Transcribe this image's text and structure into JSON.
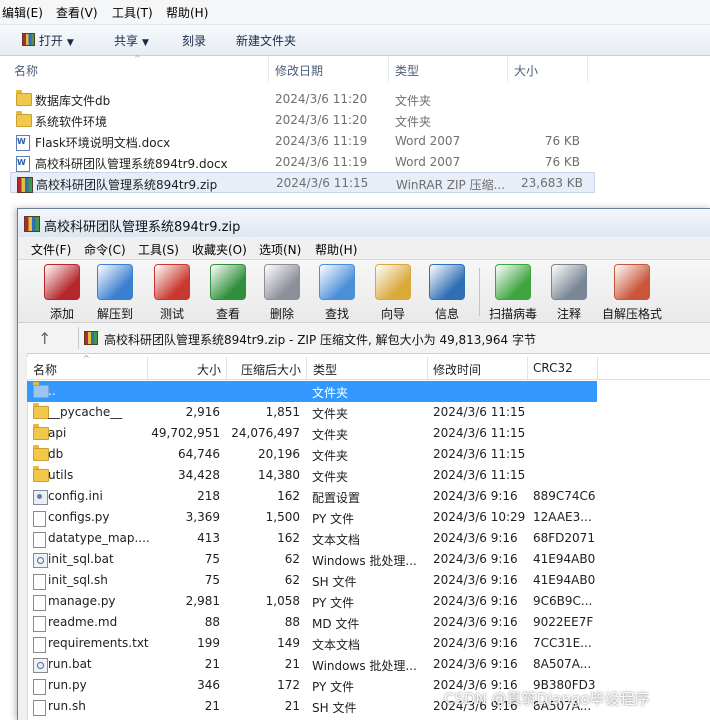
{
  "explorer": {
    "menu": [
      "编辑(E)",
      "查看(V)",
      "工具(T)",
      "帮助(H)"
    ],
    "toolbar": {
      "open": "打开",
      "share": "共享",
      "burn": "刻录",
      "new_folder": "新建文件夹"
    },
    "columns": {
      "name": "名称",
      "modified": "修改日期",
      "type": "类型",
      "size": "大小"
    },
    "rows": [
      {
        "name": "数据库文件db",
        "modified": "2024/3/6 11:20",
        "type": "文件夹",
        "size": "",
        "icon": "folder-icon"
      },
      {
        "name": "系统软件环境",
        "modified": "2024/3/6 11:20",
        "type": "文件夹",
        "size": "",
        "icon": "folder-icon"
      },
      {
        "name": "Flask环境说明文档.docx",
        "modified": "2024/3/6 11:19",
        "type": "Word 2007",
        "size": "76 KB",
        "icon": "word-doc-icon"
      },
      {
        "name": "高校科研团队管理系统894tr9.docx",
        "modified": "2024/3/6 11:19",
        "type": "Word 2007",
        "size": "76 KB",
        "icon": "word-doc-icon"
      },
      {
        "name": "高校科研团队管理系统894tr9.zip",
        "modified": "2024/3/6 11:15",
        "type": "WinRAR ZIP 压缩...",
        "size": "23,683 KB",
        "icon": "winrar-archive-icon"
      }
    ]
  },
  "winrar": {
    "title": "高校科研团队管理系统894tr9.zip",
    "menu": [
      "文件(F)",
      "命令(C)",
      "工具(S)",
      "收藏夹(O)",
      "选项(N)",
      "帮助(H)"
    ],
    "tools": [
      {
        "label": "添加",
        "icon": "add-archive-icon",
        "color": "#b4282d"
      },
      {
        "label": "解压到",
        "icon": "extract-to-icon",
        "color": "#3b7fd0"
      },
      {
        "label": "测试",
        "icon": "test-icon",
        "color": "#c8382e"
      },
      {
        "label": "查看",
        "icon": "view-book-icon",
        "color": "#2f8f3a"
      },
      {
        "label": "删除",
        "icon": "delete-trash-icon",
        "color": "#8a8f98"
      },
      {
        "label": "查找",
        "icon": "find-magnifier-icon",
        "color": "#4a90d9"
      },
      {
        "label": "向导",
        "icon": "wizard-wand-icon",
        "color": "#d9a93a"
      },
      {
        "label": "信息",
        "icon": "info-icon",
        "color": "#2f6fb5"
      },
      {
        "label": "扫描病毒",
        "icon": "virus-scan-icon",
        "color": "#3ea53e"
      },
      {
        "label": "注释",
        "icon": "comment-icon",
        "color": "#7a8696"
      },
      {
        "label": "自解压格式",
        "icon": "sfx-archive-icon",
        "color": "#c9563a"
      }
    ],
    "address": "高校科研团队管理系统894tr9.zip - ZIP 压缩文件, 解包大小为 49,813,964 字节",
    "columns": {
      "name": "名称",
      "size": "大小",
      "packed": "压缩后大小",
      "type": "类型",
      "modified": "修改时间",
      "crc": "CRC32"
    },
    "files": [
      {
        "name": "..",
        "size": "",
        "packed": "",
        "type": "文件夹",
        "modified": "",
        "crc": "",
        "icon": "updir"
      },
      {
        "name": "__pycache__",
        "size": "2,916",
        "packed": "1,851",
        "type": "文件夹",
        "modified": "2024/3/6 11:15",
        "crc": "",
        "icon": "folder"
      },
      {
        "name": "api",
        "size": "49,702,951",
        "packed": "24,076,497",
        "type": "文件夹",
        "modified": "2024/3/6 11:15",
        "crc": "",
        "icon": "folder"
      },
      {
        "name": "db",
        "size": "64,746",
        "packed": "20,196",
        "type": "文件夹",
        "modified": "2024/3/6 11:15",
        "crc": "",
        "icon": "folder"
      },
      {
        "name": "utils",
        "size": "34,428",
        "packed": "14,380",
        "type": "文件夹",
        "modified": "2024/3/6 11:15",
        "crc": "",
        "icon": "folder"
      },
      {
        "name": "config.ini",
        "size": "218",
        "packed": "162",
        "type": "配置设置",
        "modified": "2024/3/6 9:16",
        "crc": "889C74C6",
        "icon": "ini"
      },
      {
        "name": "configs.py",
        "size": "3,369",
        "packed": "1,500",
        "type": "PY 文件",
        "modified": "2024/3/6 10:29",
        "crc": "12AAE3...",
        "icon": "file"
      },
      {
        "name": "datatype_map....",
        "size": "413",
        "packed": "162",
        "type": "文本文档",
        "modified": "2024/3/6 9:16",
        "crc": "68FD2071",
        "icon": "file"
      },
      {
        "name": "init_sql.bat",
        "size": "75",
        "packed": "62",
        "type": "Windows 批处理...",
        "modified": "2024/3/6 9:16",
        "crc": "41E94AB0",
        "icon": "bat"
      },
      {
        "name": "init_sql.sh",
        "size": "75",
        "packed": "62",
        "type": "SH 文件",
        "modified": "2024/3/6 9:16",
        "crc": "41E94AB0",
        "icon": "file"
      },
      {
        "name": "manage.py",
        "size": "2,981",
        "packed": "1,058",
        "type": "PY 文件",
        "modified": "2024/3/6 9:16",
        "crc": "9C6B9C...",
        "icon": "file"
      },
      {
        "name": "readme.md",
        "size": "88",
        "packed": "88",
        "type": "MD 文件",
        "modified": "2024/3/6 9:16",
        "crc": "9022EE7F",
        "icon": "file"
      },
      {
        "name": "requirements.txt",
        "size": "199",
        "packed": "149",
        "type": "文本文档",
        "modified": "2024/3/6 9:16",
        "crc": "7CC31E...",
        "icon": "file"
      },
      {
        "name": "run.bat",
        "size": "21",
        "packed": "21",
        "type": "Windows 批处理...",
        "modified": "2024/3/6 9:16",
        "crc": "8A507A...",
        "icon": "bat"
      },
      {
        "name": "run.py",
        "size": "346",
        "packed": "172",
        "type": "PY 文件",
        "modified": "2024/3/6 9:16",
        "crc": "9B380FD3",
        "icon": "file"
      },
      {
        "name": "run.sh",
        "size": "21",
        "packed": "21",
        "type": "SH 文件",
        "modified": "2024/3/6 9:16",
        "crc": "8A507A...",
        "icon": "file"
      }
    ]
  },
  "watermark": "CSDN @真筑Django毕设程序",
  "colors": {
    "selection": "#3399ff",
    "explorer_selection": "#e8eef7"
  }
}
